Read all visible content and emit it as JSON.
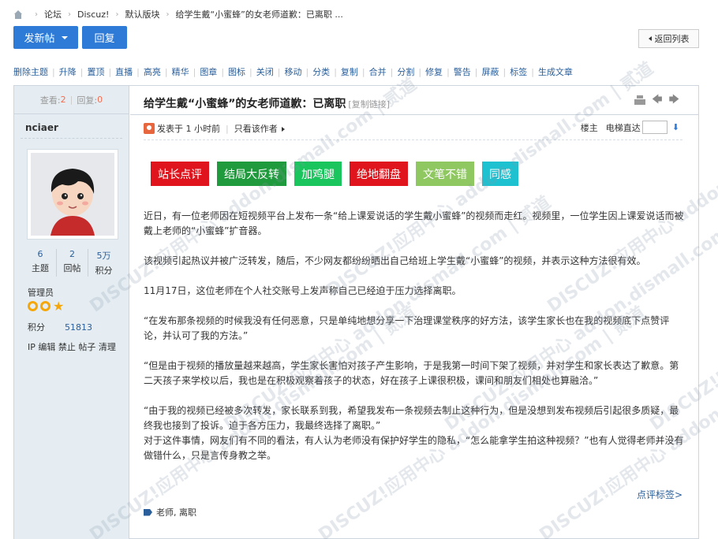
{
  "breadcrumb": {
    "items": [
      "论坛",
      "Discuz!",
      "默认版块",
      "给学生戴“小蜜蜂”的女老师道歉：已离职 ..."
    ]
  },
  "toolbar": {
    "new_post_label": "发新帖",
    "reply_label": "回复",
    "back_label": "返回列表"
  },
  "mod_actions": [
    "删除主题",
    "升降",
    "置顶",
    "直播",
    "高亮",
    "精华",
    "图章",
    "图标",
    "关闭",
    "移动",
    "分类",
    "复制",
    "合并",
    "分割",
    "修复",
    "警告",
    "屏蔽",
    "标签",
    "生成文章"
  ],
  "sidebar": {
    "views_label": "查看:",
    "views_value": "2",
    "replies_label": "回复:",
    "replies_value": "0",
    "username": "nciaer",
    "stats": [
      {
        "value": "6",
        "label": "主题"
      },
      {
        "value": "2",
        "label": "回帖"
      },
      {
        "value": "5万",
        "label": "积分"
      }
    ],
    "group": "管理员",
    "credits_label": "积分",
    "credits_value": "51813",
    "admin_links": "IP 编辑 禁止 帖子 清理"
  },
  "post": {
    "title": "给学生戴“小蜜蜂”的女老师道歉：已离职",
    "copy_link": "[复制链接]",
    "posted_at": "发表于 1 小时前",
    "author_only": "只看该作者",
    "floor_label": "楼主",
    "jump_label": "电梯直达",
    "ratings": [
      {
        "label": "站长点评",
        "color": "#e0141c"
      },
      {
        "label": "结局大反转",
        "color": "#1f9a3c"
      },
      {
        "label": "加鸡腿",
        "color": "#19c55c"
      },
      {
        "label": "绝地翻盘",
        "color": "#e0141c"
      },
      {
        "label": "文笔不错",
        "color": "#8fc860"
      },
      {
        "label": "同感",
        "color": "#1ec1cf"
      }
    ],
    "paragraphs": [
      "近日，有一位老师因在短视频平台上发布一条“给上课爱说话的学生戴小蜜蜂”的视频而走红。视频里，一位学生因上课爱说话而被戴上老师的“小蜜蜂”扩音器。",
      "该视频引起热议并被广泛转发，随后，不少网友都纷纷晒出自己给班上学生戴“小蜜蜂”的视频，并表示这种方法很有效。",
      "11月17日，这位老师在个人社交账号上发声称自己已经迫于压力选择离职。",
      "“在发布那条视频的时候我没有任何恶意，只是单纯地想分享一下治理课堂秩序的好方法，该学生家长也在我的视频底下点赞评论，并认可了我的方法。”",
      "“但是由于视频的播放量越来越高，学生家长害怕对孩子产生影响，于是我第一时间下架了视频，并对学生和家长表达了歉意。第二天孩子来学校以后，我也是在积极观察着孩子的状态，好在孩子上课很积极，课间和朋友们相处也算融洽。”",
      "“由于我的视频已经被多次转发，家长联系到我，希望我发布一条视频去制止这种行为，但是没想到发布视频后引起很多质疑，最终我也接到了投诉。迫于各方压力，我最终选择了离职。”",
      "对于这件事情，网友们有不同的看法，有人认为老师没有保护好学生的隐私，“怎么能拿学生拍这种视频？”也有人觉得老师并没有做错什么，只是言传身教之举。"
    ],
    "rate_tags_link": "点评标签>",
    "tags": "老师, 离职"
  },
  "watermark": "DISCUZ!应用中心 addon.dismall.com | 贰道"
}
